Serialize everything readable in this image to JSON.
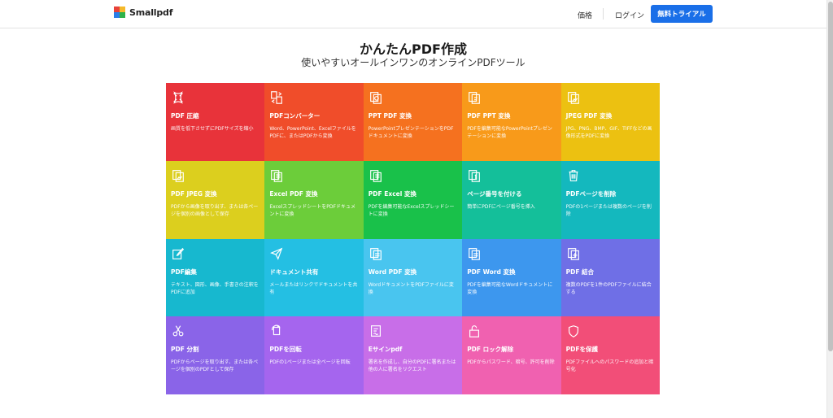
{
  "header": {
    "logo_text": "Smallpdf",
    "pricing": "価格",
    "login": "ログイン",
    "trial_button": "無料トライアル"
  },
  "hero": {
    "title": "かんたんPDF作成",
    "subtitle": "使いやすいオールインワンのオンラインPDFツール"
  },
  "colors": {
    "accent": "#1a6fe8",
    "logo": [
      "#e8423a",
      "#f5b92a",
      "#2db24a",
      "#2a7ee8"
    ]
  },
  "tools": [
    {
      "name": "PDF 圧縮",
      "desc": "画質を低下させずにPDFサイズを縮小",
      "color": "#e8333a",
      "icon": "compress-icon"
    },
    {
      "name": "PDFコンバーター",
      "desc": "Word、PowerPoint、Excelファイルを PDFに、またはPDFから変換",
      "color": "#f04d2a",
      "icon": "converter-icon"
    },
    {
      "name": "PPT PDF 変換",
      "desc": "PowerPointプレゼンテーションをPDFドキュメントに変換",
      "color": "#f5711f",
      "icon": "ppt-to-pdf-icon"
    },
    {
      "name": "PDF PPT 変換",
      "desc": "PDFを編集可能なPowerPointプレゼンテーションに変換",
      "color": "#f89a1a",
      "icon": "pdf-to-ppt-icon"
    },
    {
      "name": "JPEG PDF 変換",
      "desc": "JPG、PNG、BMP、GIF、TIFFなどの画像形式をPDFに変換",
      "color": "#ecc111",
      "icon": "jpg-to-pdf-icon"
    },
    {
      "name": "PDF JPEG 変換",
      "desc": "PDFから画像を取り出す、または各ページを個別の画像として保存",
      "color": "#dccf1e",
      "icon": "pdf-to-jpg-icon"
    },
    {
      "name": "Excel PDF 変換",
      "desc": "ExcelスプレッドシートをPDFドキュメントに変換",
      "color": "#6ccd3a",
      "icon": "excel-to-pdf-icon"
    },
    {
      "name": "PDF Excel 変換",
      "desc": "PDFを編集可能なExcelスプレッドシートに変換",
      "color": "#19c14a",
      "icon": "pdf-to-excel-icon"
    },
    {
      "name": "ページ番号を付ける",
      "desc": "簡単にPDFにページ番号を挿入",
      "color": "#14bf9a",
      "icon": "page-numbers-icon"
    },
    {
      "name": "PDFページを削除",
      "desc": "PDFの1ページまたは複数のページを削除",
      "color": "#14b8be",
      "icon": "trash-icon"
    },
    {
      "name": "PDF編集",
      "desc": "テキスト、図形、画像、手書きの注釈をPDFに追加",
      "color": "#17b8cf",
      "icon": "edit-icon"
    },
    {
      "name": "ドキュメント共有",
      "desc": "メールまたはリンクでドキュメントを共有",
      "color": "#24bfe3",
      "icon": "share-icon"
    },
    {
      "name": "Word PDF 変換",
      "desc": "WordドキュメントをPDFファイルに変換",
      "color": "#49c5ef",
      "icon": "word-to-pdf-icon"
    },
    {
      "name": "PDF Word 変換",
      "desc": "PDFを編集可能なWordドキュメントに変換",
      "color": "#3d97ee",
      "icon": "pdf-to-word-icon"
    },
    {
      "name": "PDF 結合",
      "desc": "複数のPDFを1件のPDFファイルに結合する",
      "color": "#6f6fe6",
      "icon": "merge-icon"
    },
    {
      "name": "PDF 分割",
      "desc": "PDFからページを取り出す、または各ページを個別のPDFとして保存",
      "color": "#8a64e8",
      "icon": "scissors-icon"
    },
    {
      "name": "PDFを回転",
      "desc": "PDFの1ページまたは全ページを回転",
      "color": "#a565ee",
      "icon": "rotate-icon"
    },
    {
      "name": "Eサインpdf",
      "desc": "署名を作成し、自分のPDFに署名または他の人に署名をリクエスト",
      "color": "#c86ee8",
      "icon": "esign-icon"
    },
    {
      "name": "PDF ロック解除",
      "desc": "PDFからパスワード、暗号、許可を削除",
      "color": "#f061b0",
      "icon": "unlock-icon"
    },
    {
      "name": "PDFを保護",
      "desc": "PDFファイルへのパスワードの追加と暗号化",
      "color": "#f24e78",
      "icon": "shield-icon"
    }
  ]
}
